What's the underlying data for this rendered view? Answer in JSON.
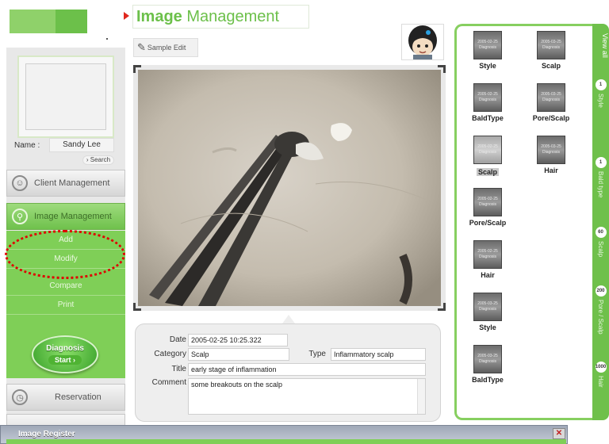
{
  "header": {
    "title_bold": "Image",
    "title_rest": "Management",
    "sample_edit_label": "Sample Edit"
  },
  "sidebar": {
    "name_label": "Name :",
    "name_value": "Sandy Lee",
    "search_label": "Search",
    "nav": [
      {
        "label": "Client Management",
        "icon": "smile-icon"
      },
      {
        "label": "Image Management",
        "icon": "magnifier-icon"
      },
      {
        "label": "Reservation",
        "icon": "clock-icon"
      }
    ],
    "submenu": [
      "Add",
      "Modify",
      "Compare",
      "Print"
    ],
    "diagnosis_label": "Diagnosis",
    "start_label": "Start"
  },
  "info": {
    "date_label": "Date",
    "date_value": "2005-02-25 10:25.322",
    "category_label": "Category",
    "category_value": "Scalp",
    "type_label": "Type",
    "type_value": "Inflammatory scalp",
    "title_label": "Title",
    "title_value": "early stage of inflammation",
    "comment_label": "Comment",
    "comment_value": "some breakouts on the scalp"
  },
  "thumbnails": [
    {
      "date": "2005-02-25",
      "text": "Diagnosis",
      "caption": "Style"
    },
    {
      "date": "2005-03-25",
      "text": "Diagnosis",
      "caption": "Scalp"
    },
    {
      "date": "2005-02-25",
      "text": "Diagnosis",
      "caption": "BaldType"
    },
    {
      "date": "2005-03-25",
      "text": "Diagnosis",
      "caption": "Pore/Scalp"
    },
    {
      "date": "2005-02-25",
      "text": "Diagnosis",
      "caption": "Scalp",
      "selected": true
    },
    {
      "date": "2005-03-25",
      "text": "Diagnosis",
      "caption": "Hair"
    },
    {
      "date": "2005-02-25",
      "text": "Diagnosis",
      "caption": "Pore/Scalp"
    },
    {
      "date": "2005-02-25",
      "text": "Diagnosis",
      "caption": "Hair"
    },
    {
      "date": "2005-03-25",
      "text": "Diagnosis",
      "caption": "Style"
    },
    {
      "date": "2005-03-25",
      "text": "Diagnosis",
      "caption": "BaldType"
    }
  ],
  "side_tabs": {
    "view_all": "View all",
    "tabs": [
      {
        "count": "1",
        "label": "Style"
      },
      {
        "count": "1",
        "label": "Bald type"
      },
      {
        "count": "60",
        "label": "Scalp"
      },
      {
        "count": "200",
        "label": "Pore / Scalp"
      },
      {
        "count": "1000",
        "label": "Hair"
      }
    ]
  },
  "dialog": {
    "title": "Image Register",
    "close_glyph": "✕"
  },
  "colors": {
    "accent_green": "#6cc04a",
    "highlight_red": "#e00000"
  }
}
